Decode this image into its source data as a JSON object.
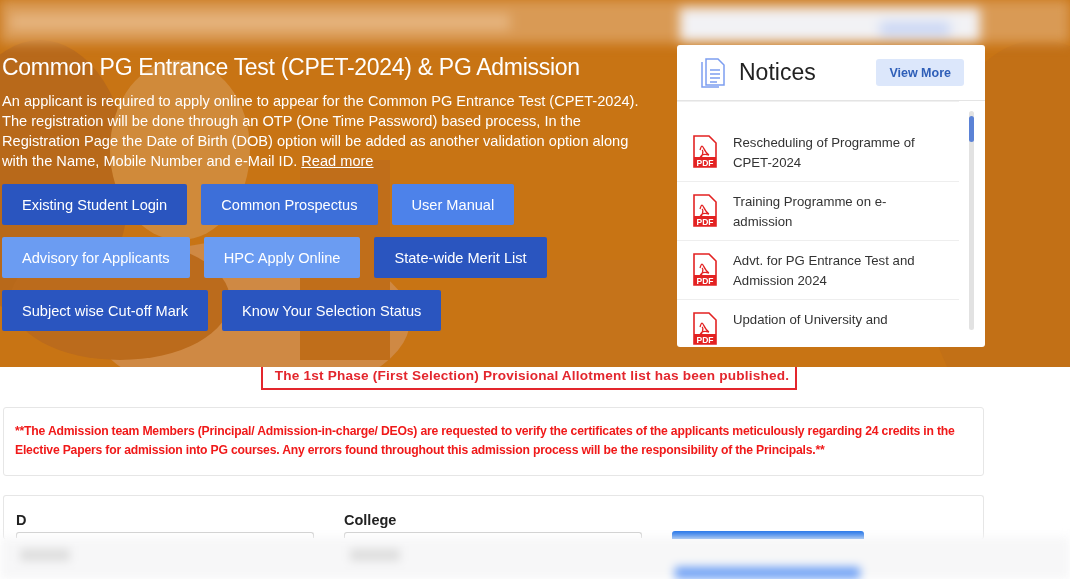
{
  "hero": {
    "title": "Common PG Entrance Test (CPET-2024) & PG Admission",
    "description": "An applicant is required to apply online to appear for the Common PG Entrance Test (CPET-2024). The registration will be done through an OTP (One Time Password) based process, In the Registration Page the Date of Birth (DOB) option will be added as another validation option along with the Name, Mobile Number and e-Mail ID.",
    "read_more": "Read more",
    "button_rows": [
      [
        {
          "label": "Existing Student Login",
          "color": "#2a55bf"
        },
        {
          "label": "Common Prospectus",
          "color": "#3d6fd9"
        },
        {
          "label": "User Manual",
          "color": "#4d82ea"
        }
      ],
      [
        {
          "label": "Advisory for Applicants",
          "color": "#6b9cf2"
        },
        {
          "label": "HPC Apply Online",
          "color": "#6b9cf2"
        },
        {
          "label": "State-wide Merit List",
          "color": "#2a55bf"
        }
      ],
      [
        {
          "label": "Subject wise Cut-off Mark",
          "color": "#2a55bf"
        },
        {
          "label": "Know Your Selection Status",
          "color": "#2a55bf"
        }
      ]
    ]
  },
  "notices": {
    "title": "Notices",
    "view_more": "View More",
    "items": [
      {
        "file_type": "PDF",
        "text": "Rescheduling of Programme of CPET-2024"
      },
      {
        "file_type": "PDF",
        "text": "Training Programme on e-admission"
      },
      {
        "file_type": "PDF",
        "text": "Advt. for PG Entrance Test and Admission 2024"
      },
      {
        "file_type": "PDF",
        "text": "Updation of University and"
      }
    ]
  },
  "announcement": "The 1st Phase (First Selection) Provisional Allotment list has been published.",
  "warning": "**The Admission team Members (Principal/ Admission-in-charge/ DEOs) are requested to verify the certificates of the applicants meticulously regarding 24 credits in the Elective Papers for admission into PG courses. Any errors found throughout this admission process will be the responsibility of the Principals.**",
  "filter": {
    "fields": [
      {
        "label": "D"
      },
      {
        "label": "College"
      }
    ]
  }
}
